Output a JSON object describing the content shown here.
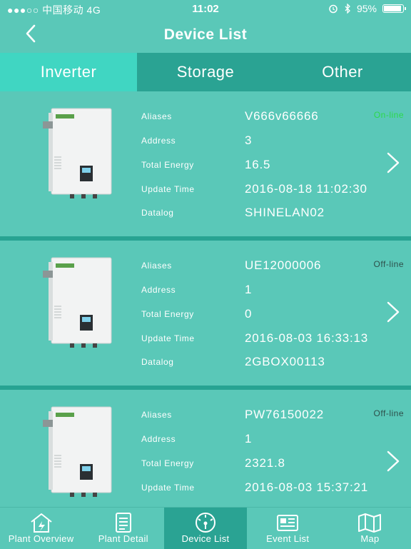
{
  "status_bar": {
    "carrier": "●●●○○ 中国移动  4G",
    "time": "11:02",
    "battery_level": "95%",
    "battery_fraction": 0.95
  },
  "nav": {
    "title": "Device List"
  },
  "tabs": [
    {
      "label": "Inverter",
      "active": true
    },
    {
      "label": "Storage",
      "active": false
    },
    {
      "label": "Other",
      "active": false
    }
  ],
  "field_labels": {
    "aliases": "Aliases",
    "address": "Address",
    "total_energy": "Total Energy",
    "update_time": "Update Time",
    "datalog": "Datalog"
  },
  "devices": [
    {
      "aliases": "V666v66666",
      "status": "On-line",
      "address": "3",
      "total_energy": "16.5",
      "update_time": "2016-08-18 11:02:30",
      "datalog": "SHINELAN02"
    },
    {
      "aliases": "UE12000006",
      "status": "Off-line",
      "address": "1",
      "total_energy": "0",
      "update_time": "2016-08-03 16:33:13",
      "datalog": "2GBOX00113"
    },
    {
      "aliases": "PW76150022",
      "status": "Off-line",
      "address": "1",
      "total_energy": "2321.8",
      "update_time": "2016-08-03 15:37:21",
      "datalog": ""
    }
  ],
  "bottom_nav": [
    {
      "label": "Plant Overview",
      "icon": "house-icon",
      "active": false
    },
    {
      "label": "Plant Detail",
      "icon": "document-icon",
      "active": false
    },
    {
      "label": "Device List",
      "icon": "gauge-icon",
      "active": true
    },
    {
      "label": "Event List",
      "icon": "newspaper-icon",
      "active": false
    },
    {
      "label": "Map",
      "icon": "map-icon",
      "active": false
    }
  ],
  "colors": {
    "background": "#5ac8b8",
    "tab_bar": "#2aa393",
    "active_tab": "#40d6c2",
    "online": "#2bd94a",
    "offline": "#2d4f4a"
  }
}
